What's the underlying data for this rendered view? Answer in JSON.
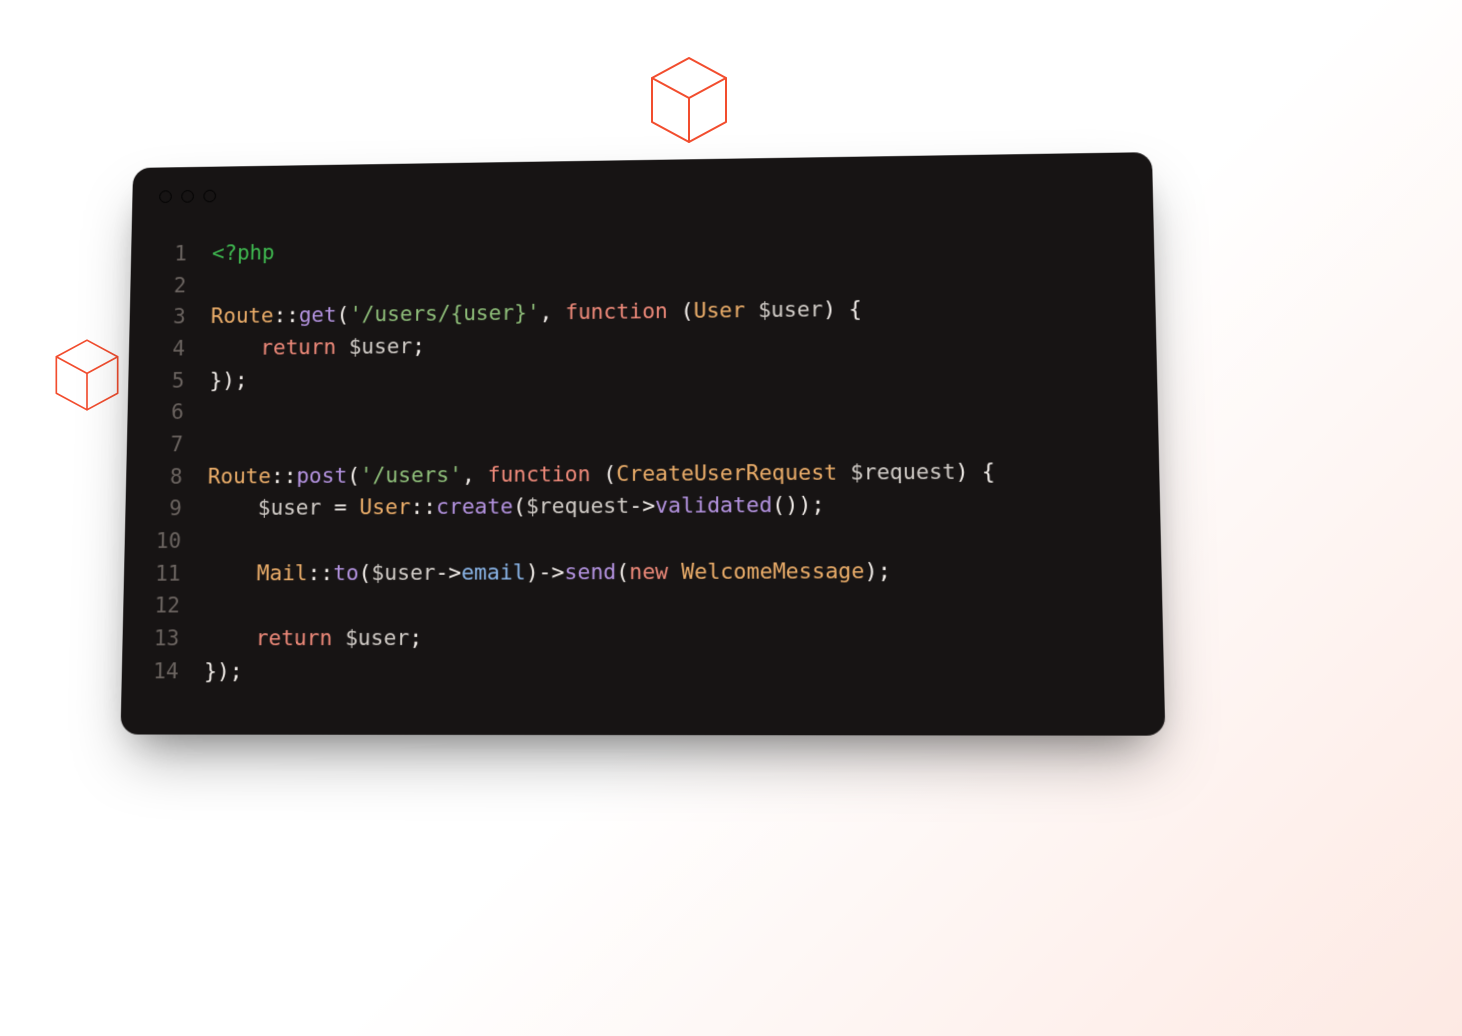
{
  "colors": {
    "accent": "#f24d2e",
    "editor_bg": "#171414"
  },
  "code": {
    "lines": [
      {
        "n": "1",
        "tokens": [
          {
            "c": "tk-phptag",
            "t": "<?php"
          }
        ]
      },
      {
        "n": "2",
        "tokens": []
      },
      {
        "n": "3",
        "tokens": [
          {
            "c": "tk-class",
            "t": "Route"
          },
          {
            "c": "tk-op",
            "t": "::"
          },
          {
            "c": "tk-method",
            "t": "get"
          },
          {
            "c": "tk-punct",
            "t": "("
          },
          {
            "c": "tk-string",
            "t": "'/users/{user}'"
          },
          {
            "c": "tk-punct",
            "t": ", "
          },
          {
            "c": "tk-keyword",
            "t": "function"
          },
          {
            "c": "tk-punct",
            "t": " ("
          },
          {
            "c": "tk-type",
            "t": "User"
          },
          {
            "c": "tk-punct",
            "t": " "
          },
          {
            "c": "tk-var",
            "t": "$user"
          },
          {
            "c": "tk-punct",
            "t": ") {"
          }
        ]
      },
      {
        "n": "4",
        "tokens": [
          {
            "c": "tk-punct",
            "t": "    "
          },
          {
            "c": "tk-keyword",
            "t": "return"
          },
          {
            "c": "tk-punct",
            "t": " "
          },
          {
            "c": "tk-var",
            "t": "$user"
          },
          {
            "c": "tk-punct",
            "t": ";"
          }
        ]
      },
      {
        "n": "5",
        "tokens": [
          {
            "c": "tk-punct",
            "t": "});"
          }
        ]
      },
      {
        "n": "6",
        "tokens": []
      },
      {
        "n": "7",
        "tokens": []
      },
      {
        "n": "8",
        "tokens": [
          {
            "c": "tk-class",
            "t": "Route"
          },
          {
            "c": "tk-op",
            "t": "::"
          },
          {
            "c": "tk-method",
            "t": "post"
          },
          {
            "c": "tk-punct",
            "t": "("
          },
          {
            "c": "tk-string",
            "t": "'/users'"
          },
          {
            "c": "tk-punct",
            "t": ", "
          },
          {
            "c": "tk-keyword",
            "t": "function"
          },
          {
            "c": "tk-punct",
            "t": " ("
          },
          {
            "c": "tk-type",
            "t": "CreateUserRequest"
          },
          {
            "c": "tk-punct",
            "t": " "
          },
          {
            "c": "tk-var",
            "t": "$request"
          },
          {
            "c": "tk-punct",
            "t": ") {"
          }
        ]
      },
      {
        "n": "9",
        "tokens": [
          {
            "c": "tk-punct",
            "t": "    "
          },
          {
            "c": "tk-var",
            "t": "$user"
          },
          {
            "c": "tk-punct",
            "t": " = "
          },
          {
            "c": "tk-type",
            "t": "User"
          },
          {
            "c": "tk-op",
            "t": "::"
          },
          {
            "c": "tk-method",
            "t": "create"
          },
          {
            "c": "tk-punct",
            "t": "("
          },
          {
            "c": "tk-var",
            "t": "$request"
          },
          {
            "c": "tk-punct",
            "t": "->"
          },
          {
            "c": "tk-method",
            "t": "validated"
          },
          {
            "c": "tk-punct",
            "t": "());"
          }
        ]
      },
      {
        "n": "10",
        "tokens": []
      },
      {
        "n": "11",
        "tokens": [
          {
            "c": "tk-punct",
            "t": "    "
          },
          {
            "c": "tk-class",
            "t": "Mail"
          },
          {
            "c": "tk-op",
            "t": "::"
          },
          {
            "c": "tk-method",
            "t": "to"
          },
          {
            "c": "tk-punct",
            "t": "("
          },
          {
            "c": "tk-var",
            "t": "$user"
          },
          {
            "c": "tk-punct",
            "t": "->"
          },
          {
            "c": "tk-prop",
            "t": "email"
          },
          {
            "c": "tk-punct",
            "t": ")->"
          },
          {
            "c": "tk-method",
            "t": "send"
          },
          {
            "c": "tk-punct",
            "t": "("
          },
          {
            "c": "tk-keyword",
            "t": "new"
          },
          {
            "c": "tk-punct",
            "t": " "
          },
          {
            "c": "tk-type",
            "t": "WelcomeMessage"
          },
          {
            "c": "tk-punct",
            "t": ");"
          }
        ]
      },
      {
        "n": "12",
        "tokens": []
      },
      {
        "n": "13",
        "tokens": [
          {
            "c": "tk-punct",
            "t": "    "
          },
          {
            "c": "tk-keyword",
            "t": "return"
          },
          {
            "c": "tk-punct",
            "t": " "
          },
          {
            "c": "tk-var",
            "t": "$user"
          },
          {
            "c": "tk-punct",
            "t": ";"
          }
        ]
      },
      {
        "n": "14",
        "tokens": [
          {
            "c": "tk-punct",
            "t": "});"
          }
        ]
      }
    ]
  }
}
